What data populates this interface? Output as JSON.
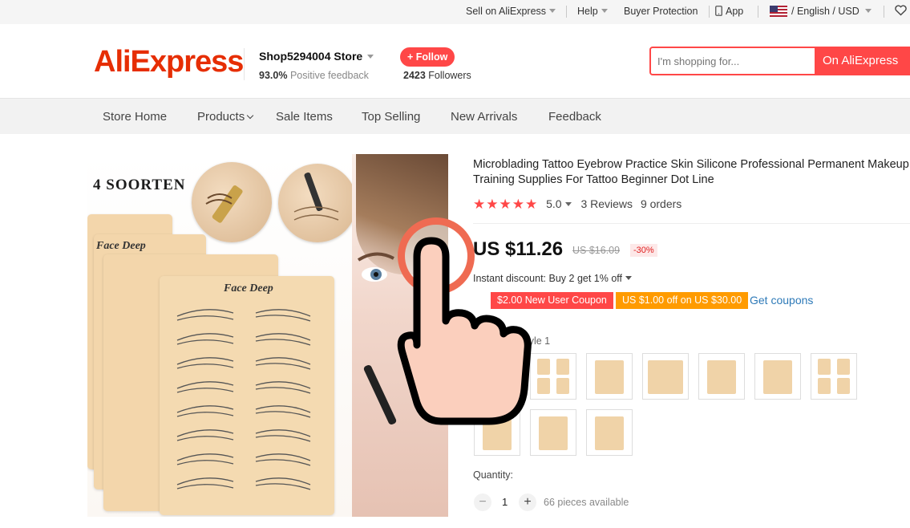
{
  "topbar": {
    "sell": "Sell on AliExpress",
    "help": "Help",
    "buyer_protection": "Buyer Protection",
    "app": "App",
    "language": "/ English /",
    "currency": "USD"
  },
  "header": {
    "logo": "AliExpress",
    "store_name": "Shop5294004 Store",
    "positive_pct": "93.0%",
    "positive_label": "Positive feedback",
    "follow_label": "+ Follow",
    "followers_count": "2423",
    "followers_label": "Followers",
    "search_placeholder": "I'm shopping for...",
    "search_button": "On AliExpress"
  },
  "nav": {
    "items": [
      "Store Home",
      "Products",
      "Sale Items",
      "Top Selling",
      "New Arrivals",
      "Feedback"
    ]
  },
  "product_image": {
    "heading": "4 SOORTEN",
    "brand": "Face Deep"
  },
  "product": {
    "title": "Microblading Tattoo Eyebrow Practice Skin Silicone Professional Permanent Makeup Training Supplies For Tattoo Beginner Dot Line",
    "stars": "★★★★★",
    "rating": "5.0",
    "reviews": "3 Reviews",
    "orders": "9 orders",
    "price": "US $11.26",
    "old_price": "US $16.09",
    "discount": "-30%",
    "instant_discount": "Instant discount: Buy 2 get 1% off",
    "coupon_new_user": "$2.00 New User Coupon",
    "coupon_store": "US $1.00 off on US $30.00",
    "get_coupons": "Get coupons",
    "color_label": "style 1",
    "quantity_label": "Quantity:",
    "quantity_value": "1",
    "minus": "−",
    "plus": "+",
    "available": "66 pieces available"
  },
  "colors": {
    "accent": "#ff4747",
    "logo": "#e62e04",
    "coupon_orange": "#ff9b00",
    "link_blue": "#2e7ab8",
    "tap_ring": "#ef6b52"
  },
  "icons": [
    "phone-icon",
    "us-flag-icon",
    "heart-icon",
    "star-icon",
    "tap-hand-icon"
  ]
}
